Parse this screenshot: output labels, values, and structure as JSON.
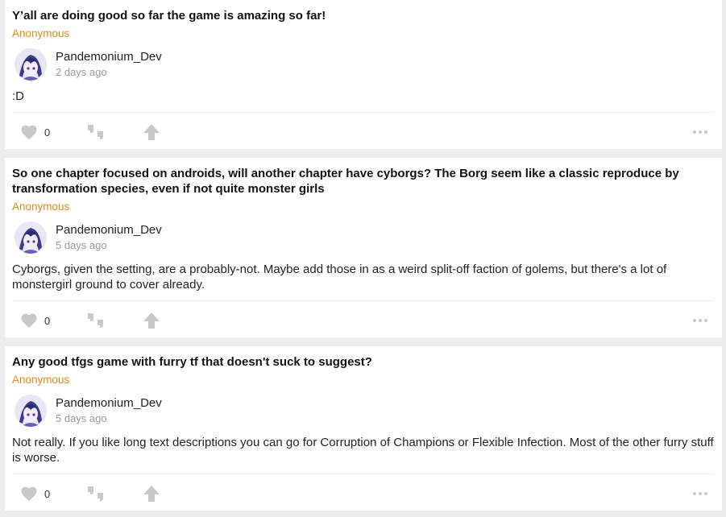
{
  "posts": [
    {
      "question": "Y’all are doing good so far the game is amazing so far!",
      "asker": "Anonymous",
      "author": "Pandemonium_Dev",
      "time": "2 days ago",
      "answer": ":D",
      "likes": "0"
    },
    {
      "question": "So one chapter focused on androids, will another chapter have cyborgs? The Borg seem like a classic reproduce by transformation species, even if not quite monster girls",
      "asker": "Anonymous",
      "author": "Pandemonium_Dev",
      "time": "5 days ago",
      "answer": "Cyborgs, given the setting, are a probably-not. Maybe add those in as a weird split-off faction of golems, but there's a lot of monstergirl ground to cover already.",
      "likes": "0"
    },
    {
      "question": "Any good tfgs game with furry tf that doesn't suck to suggest?",
      "asker": "Anonymous",
      "author": "Pandemonium_Dev",
      "time": "5 days ago",
      "answer": "Not really. If you like long text descriptions you can go for Corruption of Champions or Flexible Infection. Most of the other furry stuff is worse.",
      "likes": "0"
    }
  ],
  "icons": {
    "like": "heart-icon",
    "quote": "quote-icon",
    "share": "share-arrow-icon",
    "more": "more-dots-icon"
  },
  "colors": {
    "asker": "#e08a1c",
    "icon": "#c8c8c8",
    "time": "#9a9a9a"
  }
}
